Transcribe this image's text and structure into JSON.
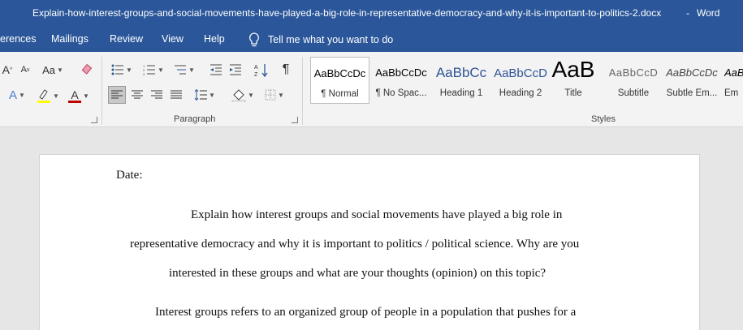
{
  "window": {
    "title": "Explain-how-interest-groups-and-social-movements-have-played-a-big-role-in-representative-democracy-and-why-it-is-important-to-politics-2.docx",
    "separator": "-",
    "app": "Word"
  },
  "tabs": [
    "erences",
    "Mailings",
    "Review",
    "View",
    "Help"
  ],
  "tell_me": "Tell me what you want to do",
  "groups": {
    "paragraph": "Paragraph",
    "styles": "Styles"
  },
  "font_buttons": {
    "grow": "A",
    "shrink": "A",
    "case": "Aa",
    "effects": "A",
    "font_color": "A"
  },
  "styles_gallery": [
    {
      "preview": "AaBbCcDc",
      "name": "¶ Normal",
      "selected": true
    },
    {
      "preview": "AaBbCcDc",
      "name": "¶ No Spac..."
    },
    {
      "preview": "AaBbCc",
      "name": "Heading 1"
    },
    {
      "preview": "AaBbCcD",
      "name": "Heading 2"
    },
    {
      "preview": "AaB",
      "name": "Title"
    },
    {
      "preview": "AaBbCcD",
      "name": "Subtitle"
    },
    {
      "preview": "AaBbCcDc",
      "name": "Subtle Em..."
    },
    {
      "preview": "AaBl",
      "name": "Em"
    }
  ],
  "colors": {
    "accent": "#2b579a",
    "highlight": "#ffff00",
    "font_color": "#c00000"
  },
  "document": {
    "date_label": "Date:",
    "lines": [
      "Explain how interest groups and social movements have played a big role in",
      "representative democracy and why it is important to politics / political science. Why are you",
      "interested in these groups and what are your thoughts (opinion) on this topic?",
      "Interest groups refers to an organized group of people in a population that pushes for a"
    ]
  }
}
